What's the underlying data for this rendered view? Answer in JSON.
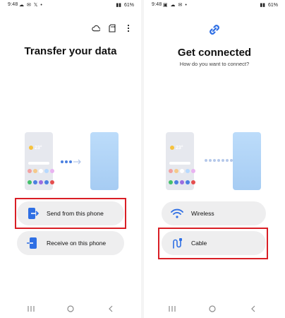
{
  "left": {
    "status": {
      "time": "9:48",
      "left_icons": [
        "cloud-icon",
        "message-icon",
        "x-icon",
        "dot-icon"
      ],
      "battery": "61%"
    },
    "toolbar": {
      "icons": [
        "cloud-icon",
        "sd-card-icon",
        "more-vert-icon"
      ]
    },
    "title": "Transfer your data",
    "weather_temp": "23°",
    "options": [
      {
        "label": "Send from this phone",
        "icon": "send-phone-icon"
      },
      {
        "label": "Receive on this phone",
        "icon": "receive-phone-icon"
      }
    ]
  },
  "right": {
    "status": {
      "time": "9:48",
      "left_icons": [
        "image-icon",
        "cloud-icon",
        "message-icon",
        "dot-icon"
      ],
      "battery": "61%"
    },
    "title": "Get connected",
    "subtitle": "How do you want to connect?",
    "weather_temp": "23°",
    "options": [
      {
        "label": "Wireless",
        "icon": "wifi-icon"
      },
      {
        "label": "Cable",
        "icon": "cable-icon"
      }
    ]
  },
  "colors": {
    "accent": "#2f6fe4",
    "highlight": "#d91e25",
    "button_bg": "#eeeeef"
  }
}
